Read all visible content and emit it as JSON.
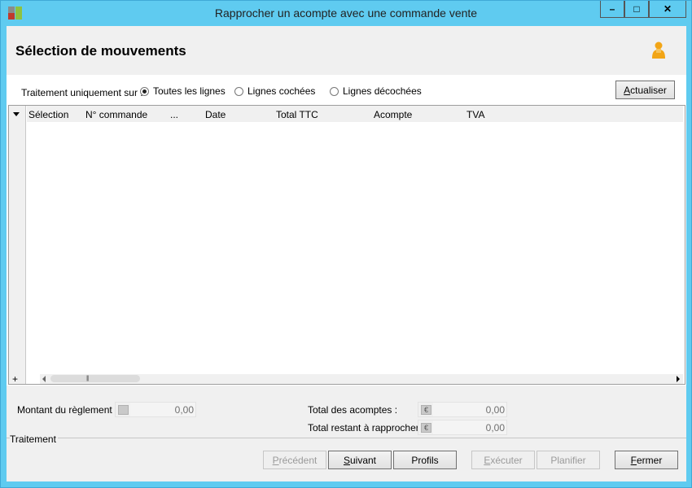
{
  "window": {
    "title": "Rapprocher un acompte avec une commande vente",
    "buttons": {
      "minimize": "–",
      "maximize": "□",
      "close": "✕"
    }
  },
  "header": {
    "title": "Sélection de mouvements"
  },
  "filter": {
    "label": "Traitement uniquement sur :",
    "options": [
      {
        "label": "Toutes les lignes",
        "checked": true
      },
      {
        "label": "Lignes cochées",
        "checked": false
      },
      {
        "label": "Lignes décochées",
        "checked": false
      }
    ],
    "refresh_label": "Actualiser"
  },
  "grid": {
    "columns": [
      "Sélection",
      "N° commande",
      "...",
      "Date",
      "Total TTC",
      "Acompte",
      "TVA"
    ],
    "rows": [],
    "add_label": "+",
    "scroll_grip": "|||"
  },
  "footer": {
    "payment_amount_label": "Montant du règlement :",
    "payment_amount_value": "0,00",
    "total_deposits_label": "Total des acomptes :",
    "total_deposits_value": "0,00",
    "total_remaining_label": "Total restant à rapprocher :",
    "total_remaining_value": "0,00",
    "currency_symbol": "€",
    "section_label": "Traitement",
    "buttons": {
      "previous": "Précédent",
      "next": "Suivant",
      "profiles": "Profils",
      "execute": "Exécuter",
      "schedule": "Planifier",
      "close": "Fermer"
    }
  },
  "colors": {
    "title_bar": "#5fcbf0",
    "background": "#f0f0f0",
    "user_icon": "#f2a516"
  }
}
